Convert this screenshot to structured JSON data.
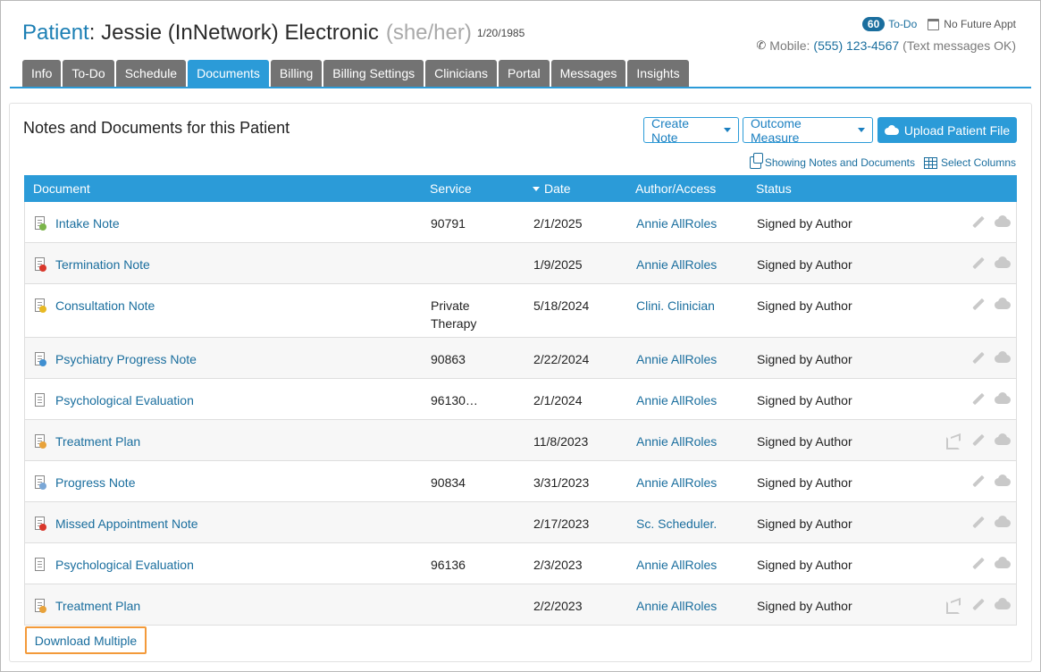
{
  "header": {
    "patient_label": "Patient",
    "patient_name": "Jessie (InNetwork) Electronic",
    "pronouns": "(she/her)",
    "dob": "1/20/1985",
    "todo_count": "60",
    "todo_label": "To-Do",
    "no_future_appt": "No Future Appt",
    "mobile_label": "Mobile:",
    "mobile_number": "(555) 123-4567",
    "mobile_note": "(Text messages OK)"
  },
  "tabs": [
    {
      "label": "Info"
    },
    {
      "label": "To-Do"
    },
    {
      "label": "Schedule"
    },
    {
      "label": "Documents",
      "active": true
    },
    {
      "label": "Billing"
    },
    {
      "label": "Billing Settings"
    },
    {
      "label": "Clinicians"
    },
    {
      "label": "Portal"
    },
    {
      "label": "Messages"
    },
    {
      "label": "Insights"
    }
  ],
  "panel": {
    "title": "Notes and Documents for this Patient",
    "create_note": "Create Note",
    "outcome_measure": "Outcome Measure",
    "upload_file": "Upload Patient File",
    "showing_link": "Showing Notes and Documents",
    "select_columns": "Select Columns",
    "download_multiple": "Download Multiple"
  },
  "table": {
    "columns": {
      "document": "Document",
      "service": "Service",
      "date": "Date",
      "author": "Author/Access",
      "status": "Status"
    },
    "rows": [
      {
        "icon": "intake-note-icon",
        "document": "Intake Note",
        "service": "90791",
        "date": "2/1/2025",
        "author": "Annie AllRoles",
        "status": "Signed by Author",
        "share": false
      },
      {
        "icon": "termination-note-icon",
        "document": "Termination Note",
        "service": "",
        "date": "1/9/2025",
        "author": "Annie AllRoles",
        "status": "Signed by Author",
        "share": false
      },
      {
        "icon": "consultation-note-icon",
        "document": "Consultation Note",
        "service": "Private Therapy",
        "date": "5/18/2024",
        "author": "Clini. Clinician",
        "status": "Signed by Author",
        "share": false
      },
      {
        "icon": "psychiatry-note-icon",
        "document": "Psychiatry Progress Note",
        "service": "90863",
        "date": "2/22/2024",
        "author": "Annie AllRoles",
        "status": "Signed by Author",
        "share": false
      },
      {
        "icon": "evaluation-icon",
        "document": "Psychological Evaluation",
        "service": "96130…",
        "date": "2/1/2024",
        "author": "Annie AllRoles",
        "status": "Signed by Author",
        "share": false
      },
      {
        "icon": "treatment-plan-icon",
        "document": "Treatment Plan",
        "service": "",
        "date": "11/8/2023",
        "author": "Annie AllRoles",
        "status": "Signed by Author",
        "share": true
      },
      {
        "icon": "progress-note-icon",
        "document": "Progress Note",
        "service": "90834",
        "date": "3/31/2023",
        "author": "Annie AllRoles",
        "status": "Signed by Author",
        "share": false
      },
      {
        "icon": "missed-appointment-icon",
        "document": "Missed Appointment Note",
        "service": "",
        "date": "2/17/2023",
        "author": "Sc. Scheduler.",
        "status": "Signed by Author",
        "share": false
      },
      {
        "icon": "evaluation-icon",
        "document": "Psychological Evaluation",
        "service": "96136",
        "date": "2/3/2023",
        "author": "Annie AllRoles",
        "status": "Signed by Author",
        "share": false
      },
      {
        "icon": "treatment-plan-icon",
        "document": "Treatment Plan",
        "service": "",
        "date": "2/2/2023",
        "author": "Annie AllRoles",
        "status": "Signed by Author",
        "share": true
      }
    ]
  },
  "icon_colors": {
    "intake-note-icon": "#7bb54a",
    "termination-note-icon": "#d9372b",
    "consultation-note-icon": "#e8b923",
    "psychiatry-note-icon": "#3f8fd1",
    "evaluation-icon": "",
    "treatment-plan-icon": "#e8a23a",
    "progress-note-icon": "#7aa7d6",
    "missed-appointment-icon": "#d9372b"
  }
}
